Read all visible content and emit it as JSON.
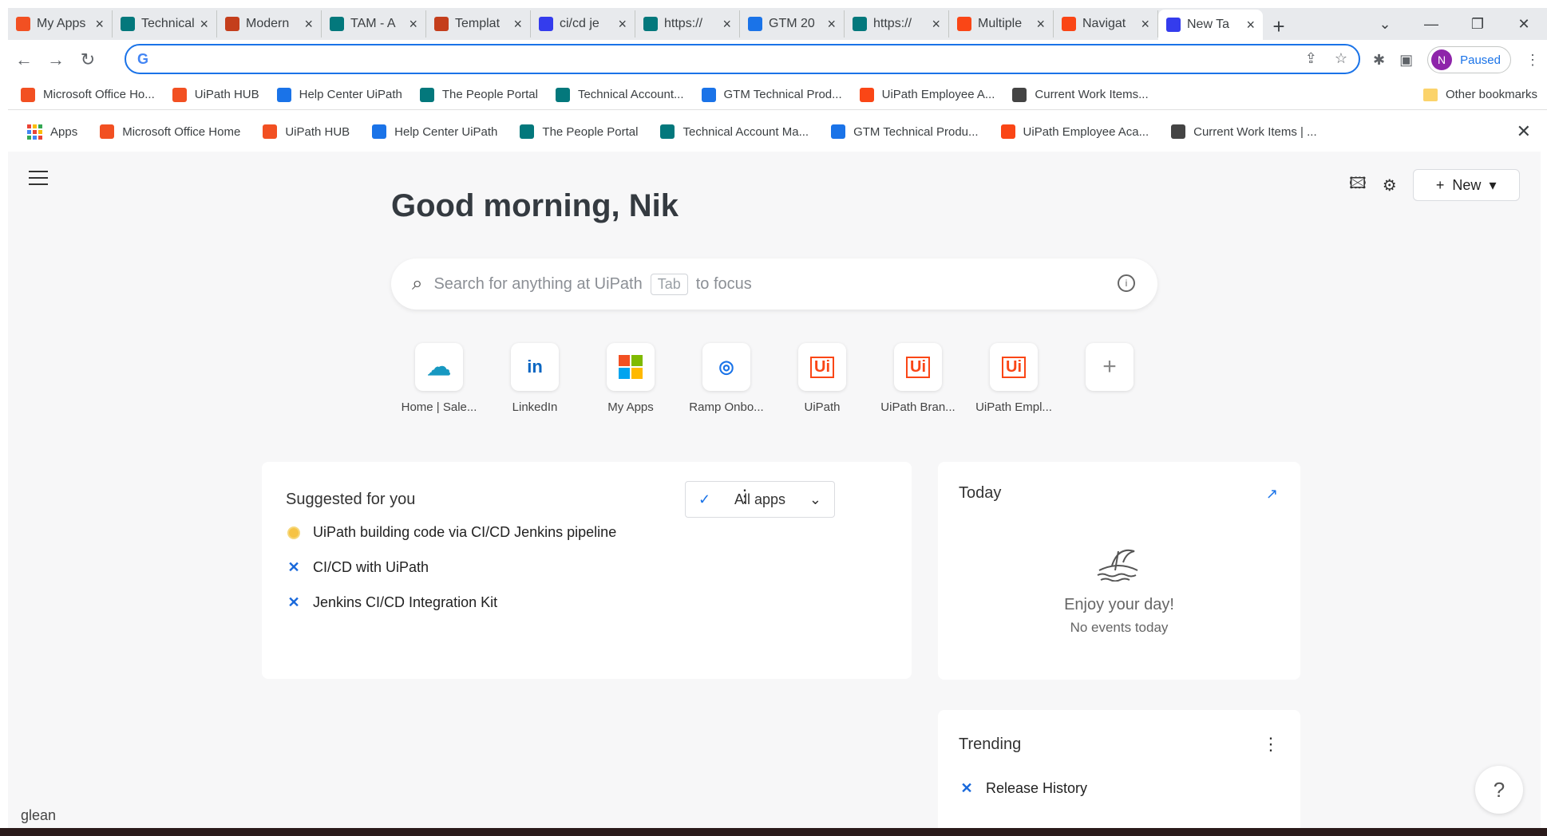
{
  "browser": {
    "tabs": [
      {
        "title": "My Apps",
        "favicon": "microsoft-icon",
        "color": "#f25022"
      },
      {
        "title": "Technical",
        "favicon": "sharepoint-icon",
        "color": "#03787c"
      },
      {
        "title": "Modern",
        "favicon": "powerpoint-icon",
        "color": "#c43e1c"
      },
      {
        "title": "TAM - A",
        "favicon": "sharepoint-icon",
        "color": "#03787c"
      },
      {
        "title": "Templat",
        "favicon": "powerpoint-icon",
        "color": "#c43e1c"
      },
      {
        "title": "ci/cd je",
        "favicon": "glean-icon",
        "color": "#343ced"
      },
      {
        "title": "https://",
        "favicon": "sharepoint-icon",
        "color": "#03787c"
      },
      {
        "title": "GTM 20",
        "favicon": "ramp-icon",
        "color": "#1a73e8"
      },
      {
        "title": "https://",
        "favicon": "sharepoint-icon",
        "color": "#03787c"
      },
      {
        "title": "Multiple",
        "favicon": "uipath-icon",
        "color": "#fa4616"
      },
      {
        "title": "Navigat",
        "favicon": "uipath-icon",
        "color": "#fa4616"
      },
      {
        "title": "New Ta",
        "favicon": "glean-icon",
        "color": "#343ced",
        "active": true
      }
    ],
    "profile": {
      "initial": "N",
      "status": "Paused"
    },
    "bookmarks": [
      {
        "label": "Microsoft Office Ho...",
        "icon": "microsoft-icon"
      },
      {
        "label": "UiPath HUB",
        "icon": "microsoft-icon"
      },
      {
        "label": "Help Center UiPath",
        "icon": "helpcenter-icon"
      },
      {
        "label": "The People Portal",
        "icon": "sharepoint-icon"
      },
      {
        "label": "Technical Account...",
        "icon": "sharepoint-icon"
      },
      {
        "label": "GTM Technical Prod...",
        "icon": "ramp-icon"
      },
      {
        "label": "UiPath Employee A...",
        "icon": "uipath-icon"
      },
      {
        "label": "Current Work Items...",
        "icon": "workitems-icon"
      }
    ],
    "other_bookmarks": "Other bookmarks",
    "ext_bookmarks": [
      {
        "label": "Apps",
        "icon": "apps-grid-icon"
      },
      {
        "label": "Microsoft Office Home",
        "icon": "microsoft-icon"
      },
      {
        "label": "UiPath HUB",
        "icon": "microsoft-icon"
      },
      {
        "label": "Help Center UiPath",
        "icon": "helpcenter-icon"
      },
      {
        "label": "The People Portal",
        "icon": "sharepoint-icon"
      },
      {
        "label": "Technical Account Ma...",
        "icon": "sharepoint-icon"
      },
      {
        "label": "GTM Technical Produ...",
        "icon": "ramp-icon"
      },
      {
        "label": "UiPath Employee Aca...",
        "icon": "uipath-icon"
      },
      {
        "label": "Current Work Items | ...",
        "icon": "workitems-icon"
      }
    ]
  },
  "page": {
    "greeting": "Good morning, Nik",
    "search": {
      "placeholder": "Search for anything at UiPath",
      "key": "Tab",
      "suffix": "to focus"
    },
    "new_button": "New",
    "apps": [
      {
        "label": "Home | Sale...",
        "icon": "salesforce-icon",
        "glyph": "☁",
        "color": "#1798c1"
      },
      {
        "label": "LinkedIn",
        "icon": "linkedin-icon",
        "glyph": "in",
        "color": "#0a66c2"
      },
      {
        "label": "My Apps",
        "icon": "microsoft-icon",
        "glyph": "",
        "color": "#f25022"
      },
      {
        "label": "Ramp Onbo...",
        "icon": "ramp-icon",
        "glyph": "◎",
        "color": "#1a73e8"
      },
      {
        "label": "UiPath",
        "icon": "uipath-icon",
        "glyph": "Ui",
        "color": "#fa4616"
      },
      {
        "label": "UiPath Bran...",
        "icon": "uipath-icon",
        "glyph": "Ui",
        "color": "#fa4616"
      },
      {
        "label": "UiPath Empl...",
        "icon": "uipath-icon",
        "glyph": "Ui",
        "color": "#fa4616"
      },
      {
        "label": "",
        "icon": "add-icon",
        "glyph": "+",
        "color": "#888888"
      }
    ],
    "suggested": {
      "title": "Suggested for you",
      "filter": "All apps",
      "items": [
        {
          "label": "UiPath building code via CI/CD Jenkins pipeline",
          "icon": "slack-channel-icon"
        },
        {
          "label": "CI/CD with UiPath",
          "icon": "confluence-icon"
        },
        {
          "label": "Jenkins CI/CD Integration Kit",
          "icon": "confluence-icon"
        }
      ]
    },
    "today": {
      "title": "Today",
      "empty_title": "Enjoy your day!",
      "empty_sub": "No events today"
    },
    "trending": {
      "title": "Trending",
      "items": [
        {
          "label": "Release History",
          "icon": "confluence-icon"
        }
      ]
    },
    "brand": "glean",
    "help": "?"
  }
}
